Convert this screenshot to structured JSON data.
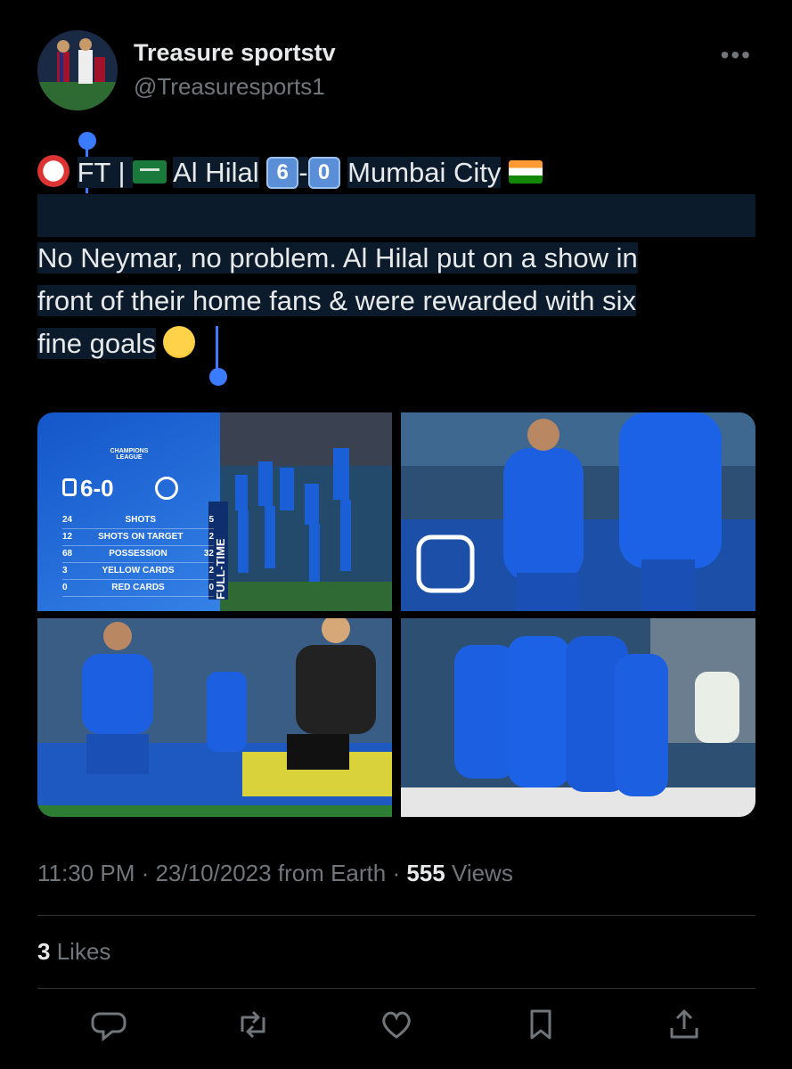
{
  "author": {
    "name": "Treasure sportstv",
    "handle": "@Treasuresports1"
  },
  "tweet": {
    "line1_prefix": "FT | ",
    "team_home": "Al Hilal",
    "score_home": "6",
    "dash": "-",
    "score_away": "0",
    "team_away": "Mumbai City",
    "body_line1": "No Neymar, no problem. Al Hilal put on a show in",
    "body_line2": "front of their home fans & were rewarded with six",
    "body_line3": "fine goals"
  },
  "media": {
    "stat_card": {
      "competition": "CHAMPIONS LEAGUE",
      "score": "6-0",
      "fulltime_label": "FULL-TIME",
      "stats": [
        {
          "home": "24",
          "label": "SHOTS",
          "away": "5"
        },
        {
          "home": "12",
          "label": "SHOTS ON TARGET",
          "away": "2"
        },
        {
          "home": "68",
          "label": "POSSESSION",
          "away": "32"
        },
        {
          "home": "3",
          "label": "YELLOW CARDS",
          "away": "2"
        },
        {
          "home": "0",
          "label": "RED CARDS",
          "away": "0"
        }
      ]
    }
  },
  "meta": {
    "time": "11:30 PM",
    "date": "23/10/2023",
    "source": "from Earth",
    "views_count": "555",
    "views_label": "Views"
  },
  "likes": {
    "count": "3",
    "label": "Likes"
  },
  "icons": [
    "reply-icon",
    "retweet-icon",
    "like-icon",
    "bookmark-icon",
    "share-icon",
    "more-icon"
  ],
  "colors": {
    "background": "#000000",
    "text": "#e7e9ea",
    "muted": "#71767b",
    "selection": "#0c1b2b",
    "cursor": "#3a7bff",
    "hilal_blue": "#1a63d8"
  }
}
